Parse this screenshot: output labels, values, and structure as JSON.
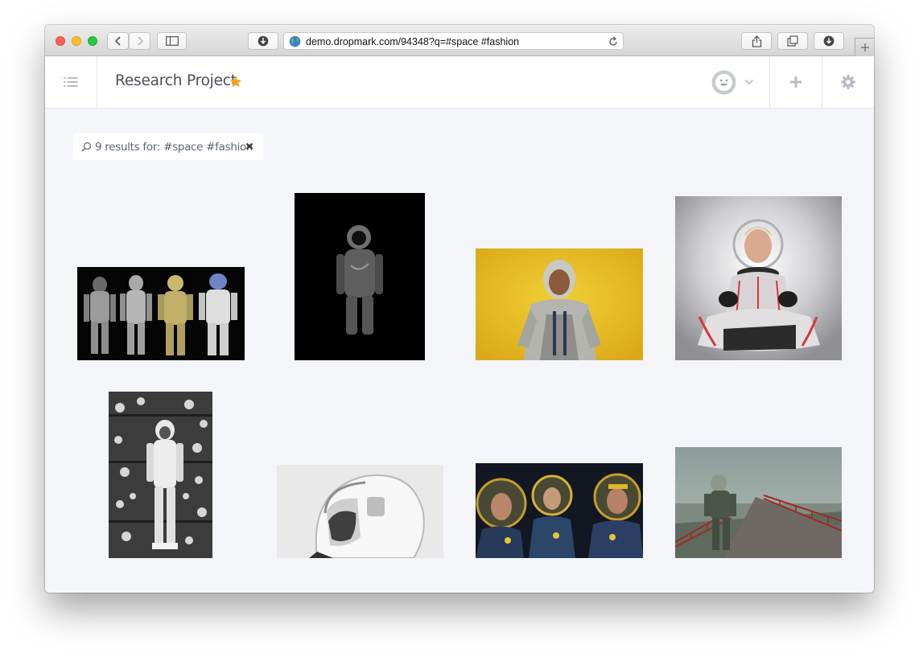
{
  "browser": {
    "url": "demo.dropmark.com/94348?q=#space #fashion"
  },
  "header": {
    "title": "Research Project",
    "accent_color": "#f5a623"
  },
  "search": {
    "summary": "9 results for: #space #fashion"
  },
  "grid": {
    "items": [
      {
        "name": "four-spacesuits-photo"
      },
      {
        "name": "black-astronaut-photo"
      },
      {
        "name": "astronaut-yellow-background-photo"
      },
      {
        "name": "woman-in-spacesuit-photo"
      },
      {
        "name": "vintage-astronaut-bw-photo"
      },
      {
        "name": "astronaut-helmet-profile-photo"
      },
      {
        "name": "three-astronauts-helmets-photo"
      },
      {
        "name": "astronaut-on-bridge-photo"
      }
    ]
  }
}
